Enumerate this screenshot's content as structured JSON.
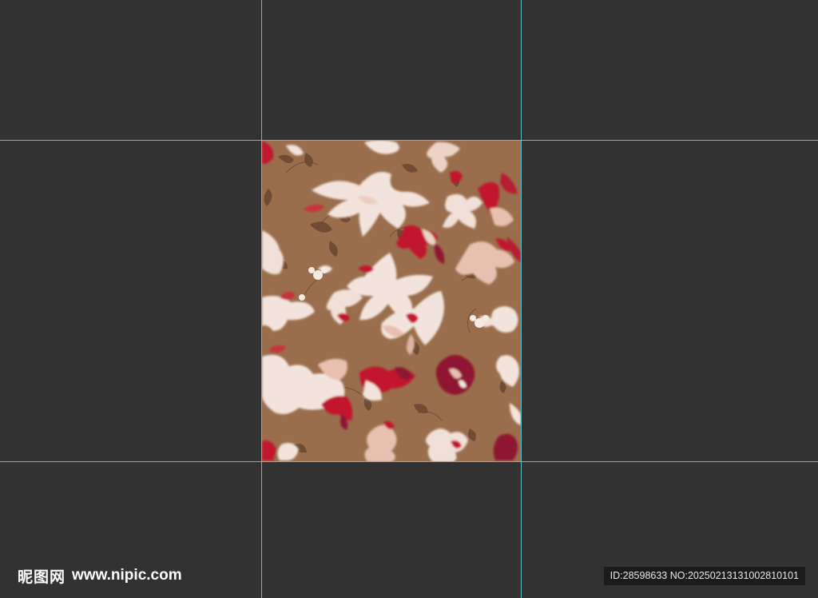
{
  "canvas": {
    "background_color": "#323232",
    "guide_color": "#6cc7d4",
    "document_background": "#9a6e4c",
    "pattern_description_colors": [
      "#f3e6df",
      "#e9c3b2",
      "#c2172e",
      "#8f1530",
      "#6a4630"
    ]
  },
  "watermark": {
    "logo_text": "昵图网",
    "url_text": "www.nipic.com",
    "id_text": "ID:28598633 NO:20250213131002810101"
  }
}
